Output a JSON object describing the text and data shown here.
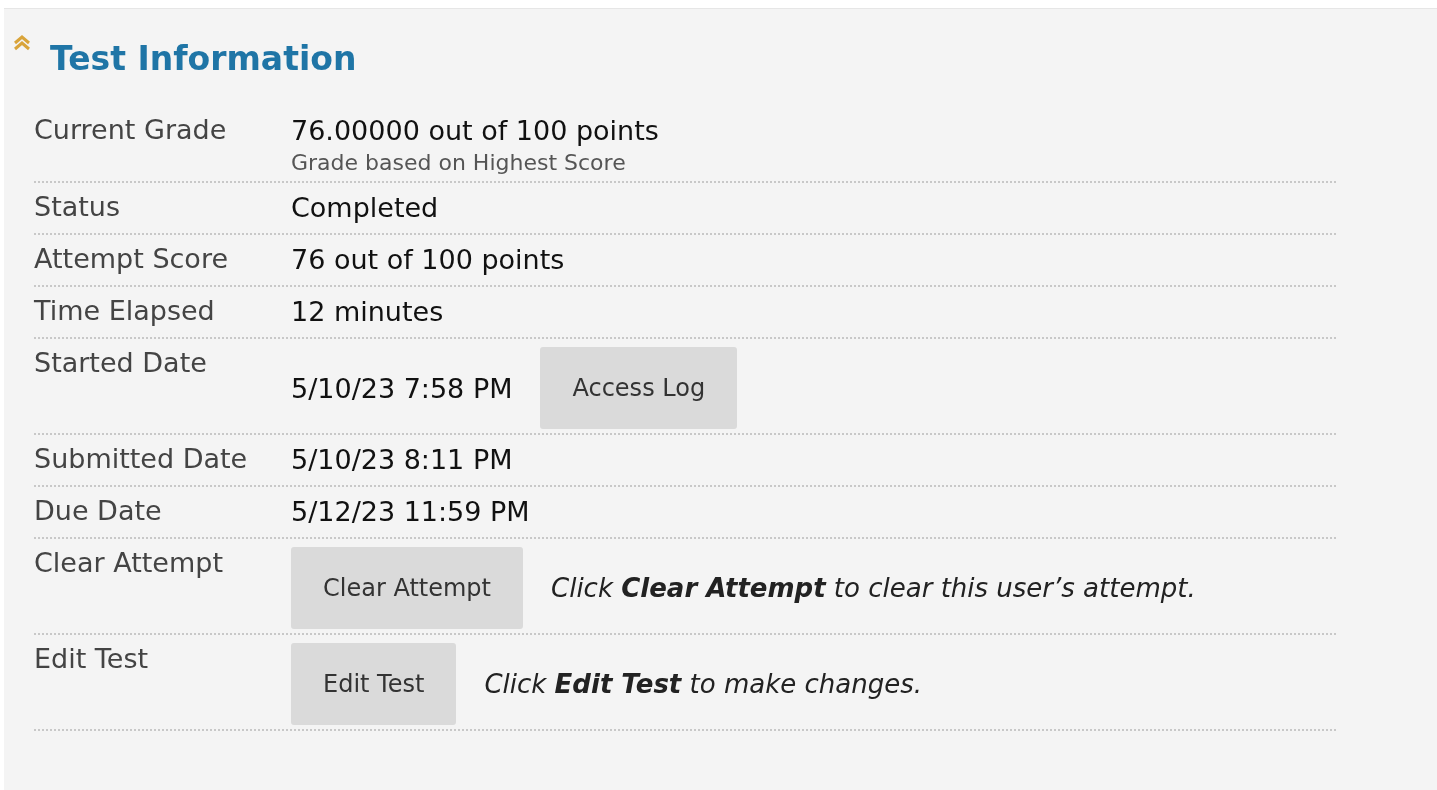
{
  "section": {
    "title": "Test Information",
    "expanded": true
  },
  "rows": [
    {
      "label": "Current Grade",
      "value": "76.00000 out of 100 points",
      "note": "Grade based on Highest Score"
    },
    {
      "label": "Status",
      "value": "Completed"
    },
    {
      "label": "Attempt Score",
      "value": "76 out of 100 points"
    },
    {
      "label": "Time Elapsed",
      "value": "12 minutes"
    },
    {
      "label": "Started Date",
      "value": "5/10/23 7:58 PM",
      "button": "Access Log"
    },
    {
      "label": "Submitted Date",
      "value": "5/10/23 8:11 PM"
    },
    {
      "label": "Due Date",
      "value": "5/12/23 11:59 PM"
    },
    {
      "label": "Clear Attempt",
      "button": "Clear Attempt",
      "help": "Click **Clear Attempt** to clear this user’s attempt."
    },
    {
      "label": "Edit Test",
      "button": "Edit Test",
      "help": "Click **Edit Test** to make changes."
    }
  ]
}
